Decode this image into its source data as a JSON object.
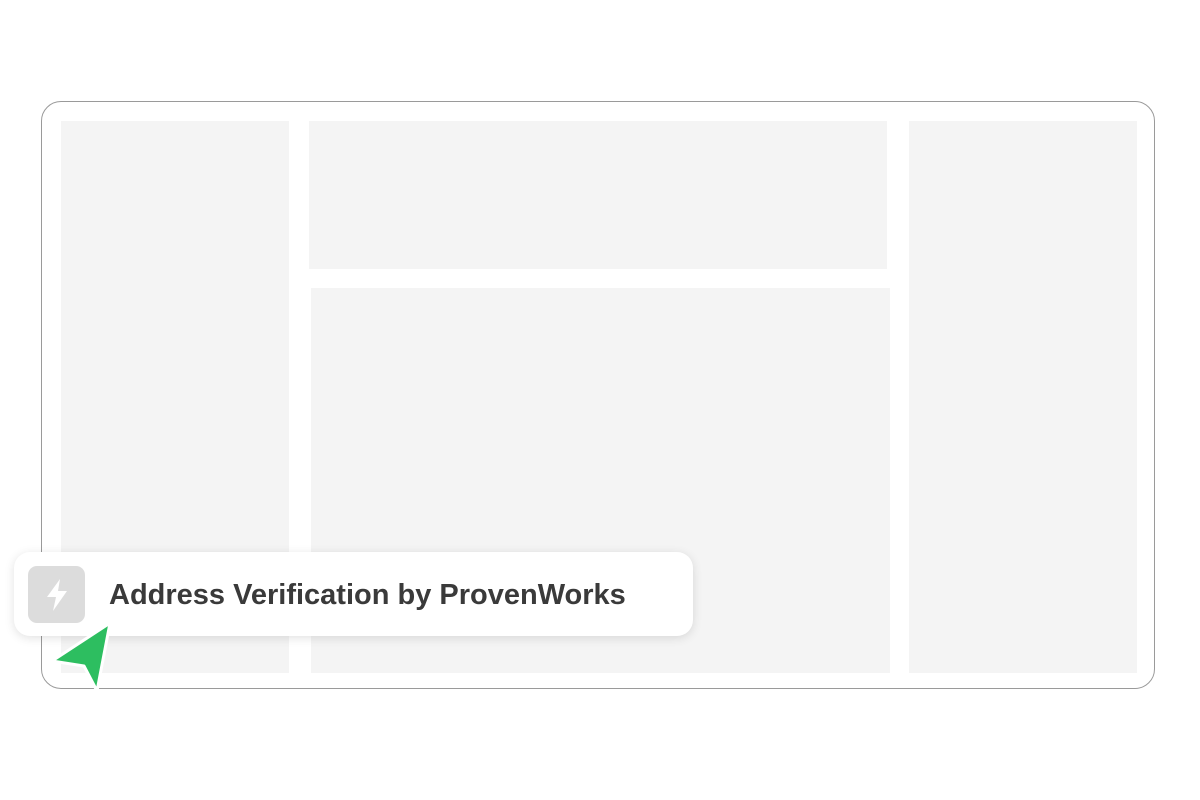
{
  "app": {
    "callout": {
      "label": "Address Verification by ProvenWorks",
      "icon": "lightning-bolt-icon"
    },
    "cursor": {
      "icon": "pointer-arrow-icon",
      "color": "#2dbe60"
    },
    "colors": {
      "panel": "#f4f4f4",
      "frame_border": "#9a9a9a",
      "icon_tile": "#dcdcdc"
    }
  }
}
